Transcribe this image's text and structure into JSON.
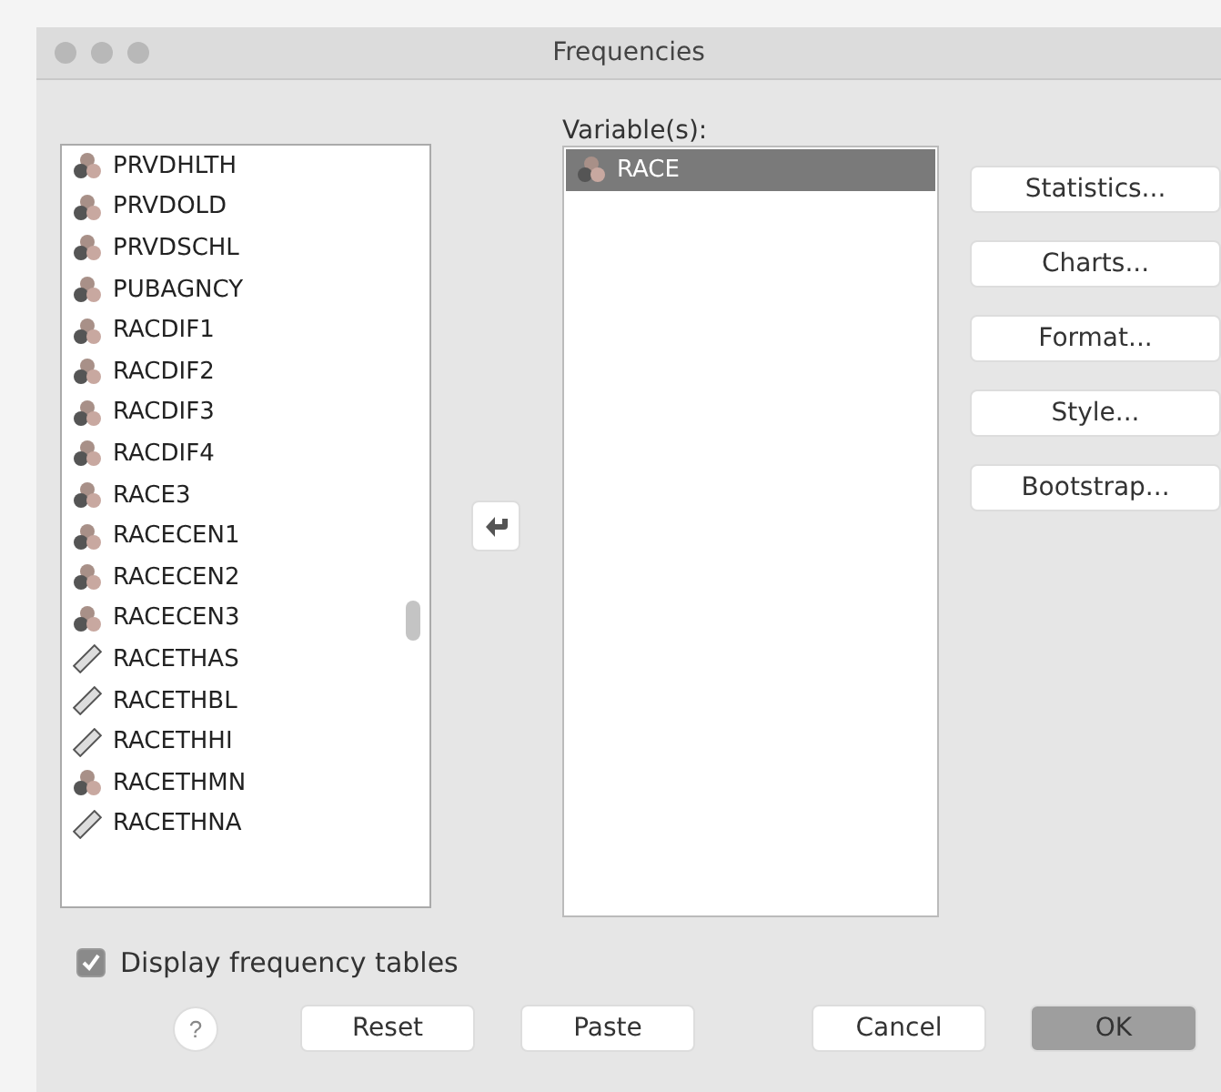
{
  "window": {
    "title": "Frequencies"
  },
  "source_list": {
    "items": [
      {
        "name": "PRVDHLTH",
        "kind": "nominal",
        "selected": false
      },
      {
        "name": "PRVDOLD",
        "kind": "nominal",
        "selected": false
      },
      {
        "name": "PRVDSCHL",
        "kind": "nominal",
        "selected": false
      },
      {
        "name": "PUBAGNCY",
        "kind": "nominal",
        "selected": false
      },
      {
        "name": "RACDIF1",
        "kind": "nominal",
        "selected": false
      },
      {
        "name": "RACDIF2",
        "kind": "nominal",
        "selected": false
      },
      {
        "name": "RACDIF3",
        "kind": "nominal",
        "selected": false
      },
      {
        "name": "RACDIF4",
        "kind": "nominal",
        "selected": false
      },
      {
        "name": "RACE3",
        "kind": "nominal",
        "selected": false
      },
      {
        "name": "RACECEN1",
        "kind": "nominal",
        "selected": false
      },
      {
        "name": "RACECEN2",
        "kind": "nominal",
        "selected": false
      },
      {
        "name": "RACECEN3",
        "kind": "nominal",
        "selected": false
      },
      {
        "name": "RACETHAS",
        "kind": "scale",
        "selected": false
      },
      {
        "name": "RACETHBL",
        "kind": "scale",
        "selected": false
      },
      {
        "name": "RACETHHI",
        "kind": "scale",
        "selected": false
      },
      {
        "name": "RACETHMN",
        "kind": "nominal",
        "selected": false
      },
      {
        "name": "RACETHNA",
        "kind": "scale",
        "selected": false
      }
    ]
  },
  "variables": {
    "label": "Variable(s):",
    "items": [
      {
        "name": "RACE",
        "kind": "nominal",
        "selected": true
      }
    ]
  },
  "side_buttons": [
    "Statistics...",
    "Charts...",
    "Format...",
    "Style...",
    "Bootstrap..."
  ],
  "display_frequency_tables": {
    "label": "Display frequency tables",
    "checked": true
  },
  "help": "?",
  "bottom_buttons": [
    {
      "label": "Reset",
      "default": false
    },
    {
      "label": "Paste",
      "default": false
    },
    {
      "label": "Cancel",
      "default": false
    },
    {
      "label": "OK",
      "default": true
    }
  ]
}
